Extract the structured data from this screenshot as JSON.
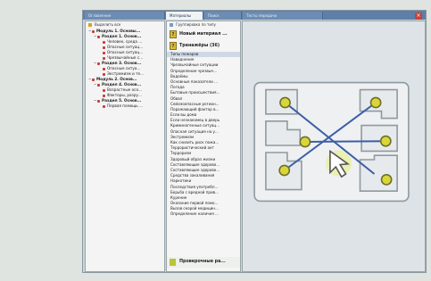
{
  "tabs": [
    {
      "label": "Оглавление"
    },
    {
      "label": "Материалы"
    },
    {
      "label": "Поиск"
    },
    {
      "label": "Тесты передачи"
    }
  ],
  "left": {
    "header": "Выделить все",
    "tree": [
      {
        "label": "Модуль 1. Основы...",
        "level": 0,
        "bold": true
      },
      {
        "label": "Раздел 1. Основ...",
        "level": 1,
        "bold": true
      },
      {
        "label": "Человек, среда ...",
        "level": 2
      },
      {
        "label": "Опасные ситуац...",
        "level": 2
      },
      {
        "label": "Опасные ситуац...",
        "level": 2
      },
      {
        "label": "Чрезвычайные с...",
        "level": 2
      },
      {
        "label": "Раздел 3. Основ...",
        "level": 1,
        "bold": true
      },
      {
        "label": "Опасные ситуа...",
        "level": 2
      },
      {
        "label": "Экстремизм и те...",
        "level": 2
      },
      {
        "label": "Модуль 2. Основ...",
        "level": 0,
        "bold": true
      },
      {
        "label": "Раздел 4. Основ...",
        "level": 1,
        "bold": true
      },
      {
        "label": "Возрастные осо...",
        "level": 2
      },
      {
        "label": "Факторы, разру...",
        "level": 2
      },
      {
        "label": "Раздел 5. Основ...",
        "level": 1,
        "bold": true
      },
      {
        "label": "Первая помощь ...",
        "level": 2
      }
    ]
  },
  "middle": {
    "header": "Группировка по типу",
    "big_items": [
      {
        "label": "Новый материал ...",
        "icon": "?"
      },
      {
        "label": "Тренажёры (36)",
        "icon": "?"
      }
    ],
    "items": [
      "Типы пожаров",
      "Наводнение",
      "Чрезвычайные ситуации",
      "Определение чрезвыч...",
      "Водоёмы",
      "Основные показатели ...",
      "Погода",
      "Бытовые происшествия...",
      "Обвал",
      "Сейсмоопасные регион...",
      "Поражающий фактор в...",
      "Если вы дома",
      "Если незнакомец в дверь",
      "Криминогенные ситуац...",
      "Опасная ситуация на у...",
      "Экстремизм",
      "Как снизить риск пожа...",
      "Террористический акт",
      "Терроризм",
      "Здоровый образ жизни",
      "Составляющие здорово...",
      "Составляющие здорово...",
      "Средства закаливания",
      "Наркотики",
      "Последствия употребл...",
      "Борьба с вредной прив...",
      "Курение",
      "Оказание первой помо...",
      "Вызов скорой медицин...",
      "Определение наличия ..."
    ],
    "bottom_item": "Проверочные ра..."
  },
  "colors": {
    "accent": "#5d7fa8",
    "circle": "#d9d63a",
    "line": "#3c5ea8",
    "board": "#eef0f2"
  }
}
